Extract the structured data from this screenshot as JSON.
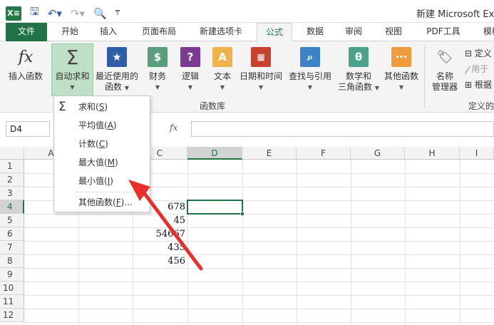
{
  "title": "新建 Microsoft Ex",
  "tabs": [
    "文件",
    "开始",
    "插入",
    "页面布局",
    "新建选项卡",
    "公式",
    "数据",
    "审阅",
    "视图",
    "PDF工具",
    "模板"
  ],
  "ribbon": {
    "insert_function": "插入函数",
    "autosum_l1": "自动求和",
    "recent_l1": "最近使用的",
    "recent_l2": "函数",
    "financial": "财务",
    "logical": "逻辑",
    "text": "文本",
    "datetime": "日期和时间",
    "lookup": "查找与引用",
    "math_l1": "数学和",
    "math_l2": "三角函数",
    "other": "其他函数",
    "name_mgr_l1": "名称",
    "name_mgr_l2": "管理器",
    "define_name": "定义",
    "use_in": "用于",
    "create_sel": "根据",
    "group_library": "函数库",
    "group_defined": "定义的"
  },
  "formula_bar": {
    "name_box": "D4",
    "fx": "fx",
    "value": ""
  },
  "columns": [
    "A",
    "B",
    "C",
    "D",
    "E",
    "F",
    "G",
    "H",
    "I"
  ],
  "rows": [
    "1",
    "2",
    "3",
    "4",
    "5",
    "6",
    "7",
    "8",
    "9",
    "10",
    "11",
    "12"
  ],
  "cells": {
    "c4": "678",
    "c5": "45",
    "c6": "54667",
    "c7": "435",
    "c8": "456"
  },
  "menu": {
    "sum": "求和(",
    "sum_key": "S",
    "sum_end": ")",
    "avg": "平均值(",
    "avg_key": "A",
    "avg_end": ")",
    "count": "计数(",
    "count_key": "C",
    "count_end": ")",
    "max": "最大值(",
    "max_key": "M",
    "max_end": ")",
    "min": "最小值(",
    "min_key": "I",
    "min_end": ")",
    "more": "其他函数(",
    "more_key": "F",
    "more_end": ")..."
  },
  "colors": {
    "excel_green": "#217346",
    "arrow": "#e8302a"
  }
}
